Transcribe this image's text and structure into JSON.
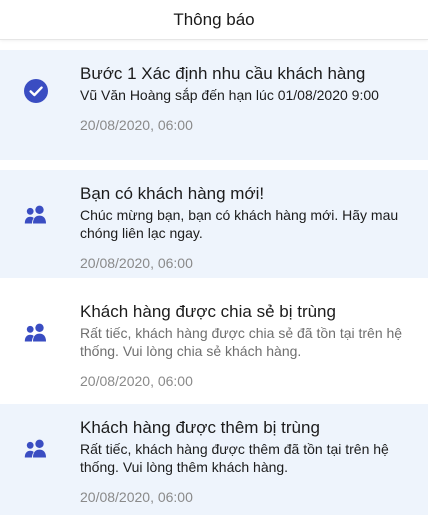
{
  "header": {
    "title": "Thông báo"
  },
  "colors": {
    "accent": "#3a4dc2",
    "unread_bg": "#eef4fc",
    "read_bg": "#ffffff"
  },
  "notifications": [
    {
      "icon": "check-circle-icon",
      "title": "Bước 1 Xác định nhu cầu khách hàng",
      "description": "Vũ Văn Hoàng sắp đến hạn lúc 01/08/2020 9:00",
      "time": "20/08/2020, 06:00"
    },
    {
      "icon": "users-icon",
      "title": "Bạn có khách hàng mới!",
      "description": "Chúc mừng bạn, bạn có khách hàng mới. Hãy mau chóng liên lạc ngay.",
      "time": "20/08/2020, 06:00"
    },
    {
      "icon": "users-icon",
      "title": "Khách hàng được chia sẻ bị trùng",
      "description": "Rất tiếc, khách hàng được chia sẻ đã tồn tại trên hệ thống. Vui lòng chia sẻ khách hàng.",
      "time": "20/08/2020, 06:00"
    },
    {
      "icon": "users-icon",
      "title": "Khách hàng được thêm bị trùng",
      "description": "Rất tiếc, khách hàng được thêm đã tồn tại trên hệ thống. Vui lòng thêm khách hàng.",
      "time": "20/08/2020, 06:00"
    }
  ]
}
